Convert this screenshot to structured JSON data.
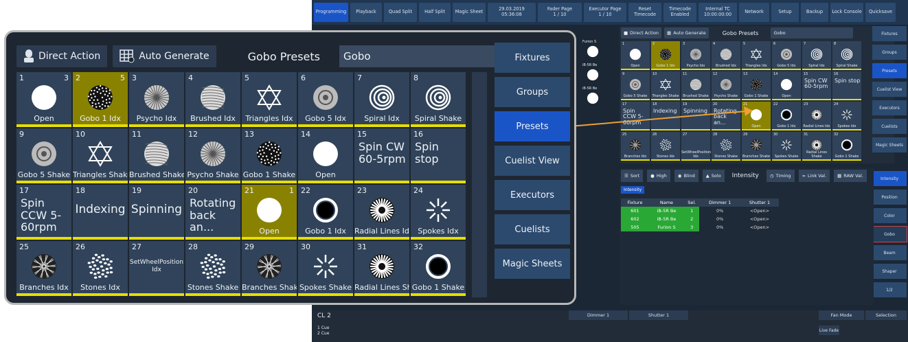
{
  "topbar": [
    {
      "label": "Programming",
      "active": true
    },
    {
      "label": "Playback"
    },
    {
      "label": "Quad Split"
    },
    {
      "label": "Half Split"
    },
    {
      "label": "Magic Sheet"
    },
    {
      "label": "29.03.2019\n05:36:08"
    },
    {
      "label": "Fader Page\n1 / 10"
    },
    {
      "label": "Executor Page\n1 / 10"
    },
    {
      "label": "Reset\nTimecode"
    },
    {
      "label": "Timecode\nEnabled"
    },
    {
      "label": "Internal TC\n10:00:00:00"
    },
    {
      "label": "Network"
    },
    {
      "label": "Setup"
    },
    {
      "label": "Backup"
    },
    {
      "label": "Lock Console"
    },
    {
      "label": "Quicksave"
    }
  ],
  "mini": {
    "direct_action": "Direct Action",
    "auto_generate": "Auto Generate",
    "title": "Gobo Presets",
    "dropdown": "Gobo",
    "cells": [
      {
        "n": "1",
        "label": "Open",
        "icon": "open"
      },
      {
        "n": "2",
        "label": "Gobo 1 Idx",
        "icon": "dots",
        "sel": true
      },
      {
        "n": "3",
        "label": "Psycho Idx",
        "icon": "psycho"
      },
      {
        "n": "4",
        "label": "Brushed Idx",
        "icon": "brushed"
      },
      {
        "n": "5",
        "label": "Triangles Idx",
        "icon": "triangles"
      },
      {
        "n": "6",
        "label": "Gobo 5 Idx",
        "icon": "gobo5"
      },
      {
        "n": "7",
        "label": "Spiral Idx",
        "icon": "spiral"
      },
      {
        "n": "8",
        "label": "Spiral Shake",
        "icon": "spiral"
      },
      {
        "n": "9",
        "label": "Gobo 5 Shake",
        "icon": "gobo5"
      },
      {
        "n": "10",
        "label": "Triangles Shake",
        "icon": "triangles"
      },
      {
        "n": "11",
        "label": "Brushed Shake",
        "icon": "brushed"
      },
      {
        "n": "12",
        "label": "Psycho Shake",
        "icon": "psycho"
      },
      {
        "n": "13",
        "label": "Gobo 1 Shake",
        "icon": "dots"
      },
      {
        "n": "14",
        "label": "Open",
        "icon": "open"
      },
      {
        "n": "15",
        "text": "Spin CW 60-5rpm"
      },
      {
        "n": "16",
        "text": "Spin stop"
      },
      {
        "n": "17",
        "text": "Spin CCW 5-60rpm"
      },
      {
        "n": "18",
        "text": "Indexing"
      },
      {
        "n": "19",
        "text": "Spinning"
      },
      {
        "n": "20",
        "text": "Rotating back an..."
      },
      {
        "n": "21",
        "label": "Open",
        "icon": "open",
        "sel": true
      },
      {
        "n": "22",
        "label": "Gobo 1 Idx",
        "icon": "ring"
      },
      {
        "n": "23",
        "label": "Radial Lines Idx",
        "icon": "radial"
      },
      {
        "n": "24",
        "label": "Spokes Idx",
        "icon": "spokes"
      },
      {
        "n": "25",
        "label": "Branches Idx",
        "icon": "branches"
      },
      {
        "n": "26",
        "label": "Stones Idx",
        "icon": "stones"
      },
      {
        "n": "27",
        "label": "SetWheelPosition Idx",
        "small": true
      },
      {
        "n": "28",
        "label": "Stones Shake",
        "icon": "stones"
      },
      {
        "n": "29",
        "label": "Branches Shake",
        "icon": "branches"
      },
      {
        "n": "30",
        "label": "Spokes Shake",
        "icon": "spokes"
      },
      {
        "n": "31",
        "label": "Radial Lines Shake",
        "icon": "radial"
      },
      {
        "n": "32",
        "label": "Gobo 1 Shake",
        "icon": "ring"
      }
    ]
  },
  "right_sidebar": [
    {
      "label": "Fixtures"
    },
    {
      "label": "Groups"
    },
    {
      "label": "Presets",
      "active": true
    },
    {
      "label": "Cuelist View"
    },
    {
      "label": "Executors"
    },
    {
      "label": "Cuelists"
    },
    {
      "label": "Magic Sheets"
    }
  ],
  "attr_sidebar": [
    {
      "label": "Intensity",
      "active": true
    },
    {
      "label": "Position"
    },
    {
      "label": "Color"
    },
    {
      "label": "Gobo",
      "red": true
    },
    {
      "label": "Beam"
    },
    {
      "label": "Shaper"
    },
    {
      "label": "1/2"
    }
  ],
  "fixture_toolbar": {
    "sort": "Sort",
    "high": "High",
    "blind": "Blind",
    "solo": "Solo",
    "title": "Intensity",
    "timing": "Timing",
    "link": "Link Val.",
    "raw": "RAW Val."
  },
  "intensity_tab": "Intensity",
  "table": {
    "headers": [
      "Fixture",
      "Name",
      "Sel.",
      "Dimmer 1",
      "Shutter 1"
    ],
    "rows": [
      [
        "601",
        "iB-5R Be",
        "1",
        "0%",
        "<Open>"
      ],
      [
        "602",
        "iB-5R Be",
        "2",
        "0%",
        "<Open>"
      ],
      [
        "505",
        "Furion S",
        "3",
        "0%",
        "<Open>"
      ]
    ]
  },
  "bottom": {
    "cuelist": "CL 2",
    "cue1": "1 Cue",
    "cue2": "2 Cue",
    "dimmer": "Dimmer 1",
    "shutter": "Shutter 1",
    "fan_mode": "Fan Mode",
    "selection": "Selection",
    "live_fade": "Live Fade"
  },
  "mini_fixture_labels": [
    "Furion S",
    "iB-5R Be",
    "iB-5R Be"
  ],
  "zoom": {
    "direct_action": "Direct Action",
    "auto_generate": "Auto Generate",
    "title": "Gobo Presets",
    "dropdown": "Gobo",
    "side": [
      {
        "label": "Fixtures"
      },
      {
        "label": "Groups"
      },
      {
        "label": "Presets",
        "active": true
      },
      {
        "label": "Cuelist View"
      },
      {
        "label": "Executors"
      },
      {
        "label": "Cuelists"
      },
      {
        "label": "Magic Sheets"
      }
    ],
    "cells": [
      {
        "n": "1",
        "c": "3",
        "label": "Open",
        "icon": "open"
      },
      {
        "n": "2",
        "c": "5",
        "label": "Gobo 1 Idx",
        "icon": "dots",
        "sel": true
      },
      {
        "n": "3",
        "label": "Psycho Idx",
        "icon": "psycho"
      },
      {
        "n": "4",
        "label": "Brushed Idx",
        "icon": "brushed"
      },
      {
        "n": "5",
        "label": "Triangles Idx",
        "icon": "triangles"
      },
      {
        "n": "6",
        "label": "Gobo 5 Idx",
        "icon": "gobo5"
      },
      {
        "n": "7",
        "label": "Spiral Idx",
        "icon": "spiral"
      },
      {
        "n": "8",
        "label": "Spiral Shake",
        "icon": "spiral"
      },
      {
        "n": "9",
        "label": "Gobo 5 Shake",
        "icon": "gobo5"
      },
      {
        "n": "10",
        "label": "Triangles Shake",
        "icon": "triangles"
      },
      {
        "n": "11",
        "label": "Brushed Shake",
        "icon": "brushed"
      },
      {
        "n": "12",
        "label": "Psycho Shake",
        "icon": "psycho"
      },
      {
        "n": "13",
        "label": "Gobo 1 Shake",
        "icon": "dots"
      },
      {
        "n": "14",
        "label": "Open",
        "icon": "open"
      },
      {
        "n": "15",
        "text": "Spin CW 60-5rpm"
      },
      {
        "n": "16",
        "text": "Spin stop"
      },
      {
        "n": "17",
        "text": "Spin CCW 5-60rpm"
      },
      {
        "n": "18",
        "tc": "Indexing"
      },
      {
        "n": "19",
        "tc": "Spinning"
      },
      {
        "n": "20",
        "text": "Rotating back an..."
      },
      {
        "n": "21",
        "c": "1",
        "label": "Open",
        "icon": "open",
        "sel": true
      },
      {
        "n": "22",
        "label": "Gobo 1 Idx",
        "icon": "ring"
      },
      {
        "n": "23",
        "label": "Radial Lines Idx",
        "icon": "radial"
      },
      {
        "n": "24",
        "label": "Spokes Idx",
        "icon": "spokes"
      },
      {
        "n": "25",
        "label": "Branches Idx",
        "icon": "branches"
      },
      {
        "n": "26",
        "label": "Stones Idx",
        "icon": "stones"
      },
      {
        "n": "27",
        "small": "SetWheelPosition Idx"
      },
      {
        "n": "28",
        "label": "Stones Shake",
        "icon": "stones"
      },
      {
        "n": "29",
        "label": "Branches Shake",
        "icon": "branches"
      },
      {
        "n": "30",
        "label": "Spokes Shake",
        "icon": "spokes"
      },
      {
        "n": "31",
        "label": "Radial Lines Shake",
        "icon": "radial"
      },
      {
        "n": "32",
        "label": "Gobo 1 Shake",
        "icon": "ring"
      }
    ]
  },
  "colors": {
    "accent": "#1a55c8",
    "selected": "#898200",
    "underline": "#e7de00",
    "callout": "#f0a033"
  }
}
